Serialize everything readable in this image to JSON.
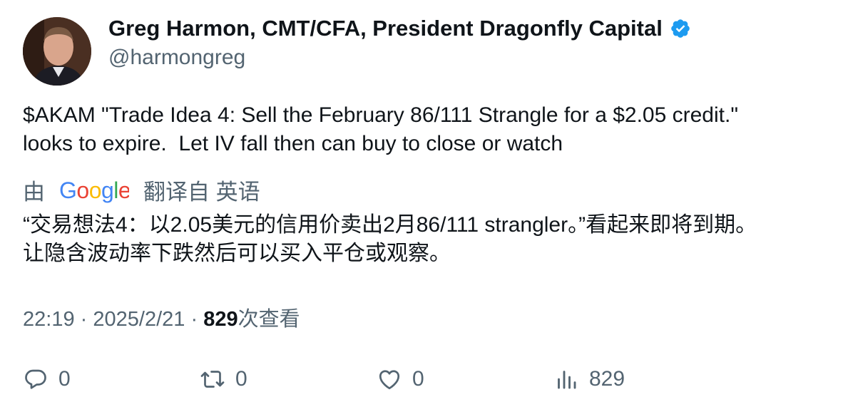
{
  "author": {
    "display_name": "Greg Harmon, CMT/CFA, President Dragonfly Capital",
    "handle": "@harmongreg"
  },
  "tweet": {
    "text": "$AKAM \"Trade Idea 4: Sell the February 86/111 Strangle for a $2.05 credit.\"\nlooks to expire.  Let IV fall then can buy to close or watch"
  },
  "translation": {
    "prefix": "由",
    "provider": "Google",
    "suffix": "翻译自 英语",
    "text": "“交易想法4：以2.05美元的信用价卖出2月86/111 strangler。”看起来即将到期。\n让隐含波动率下跌然后可以买入平仓或观察。"
  },
  "meta": {
    "time": "22:19",
    "separator": "·",
    "date": "2025/2/21",
    "views_count": "829",
    "views_label": "次查看"
  },
  "actions": {
    "reply_count": "0",
    "retweet_count": "0",
    "like_count": "0",
    "views_count": "829"
  },
  "colors": {
    "verified": "#1d9bf0",
    "secondary_text": "#536471",
    "primary_text": "#0f1419",
    "google_blue": "#4285F4",
    "google_red": "#EA4335",
    "google_yellow": "#FBBC05",
    "google_green": "#34A853"
  },
  "icons": [
    "verified-badge-icon",
    "reply-icon",
    "retweet-icon",
    "like-icon",
    "views-icon",
    "google-logo"
  ]
}
